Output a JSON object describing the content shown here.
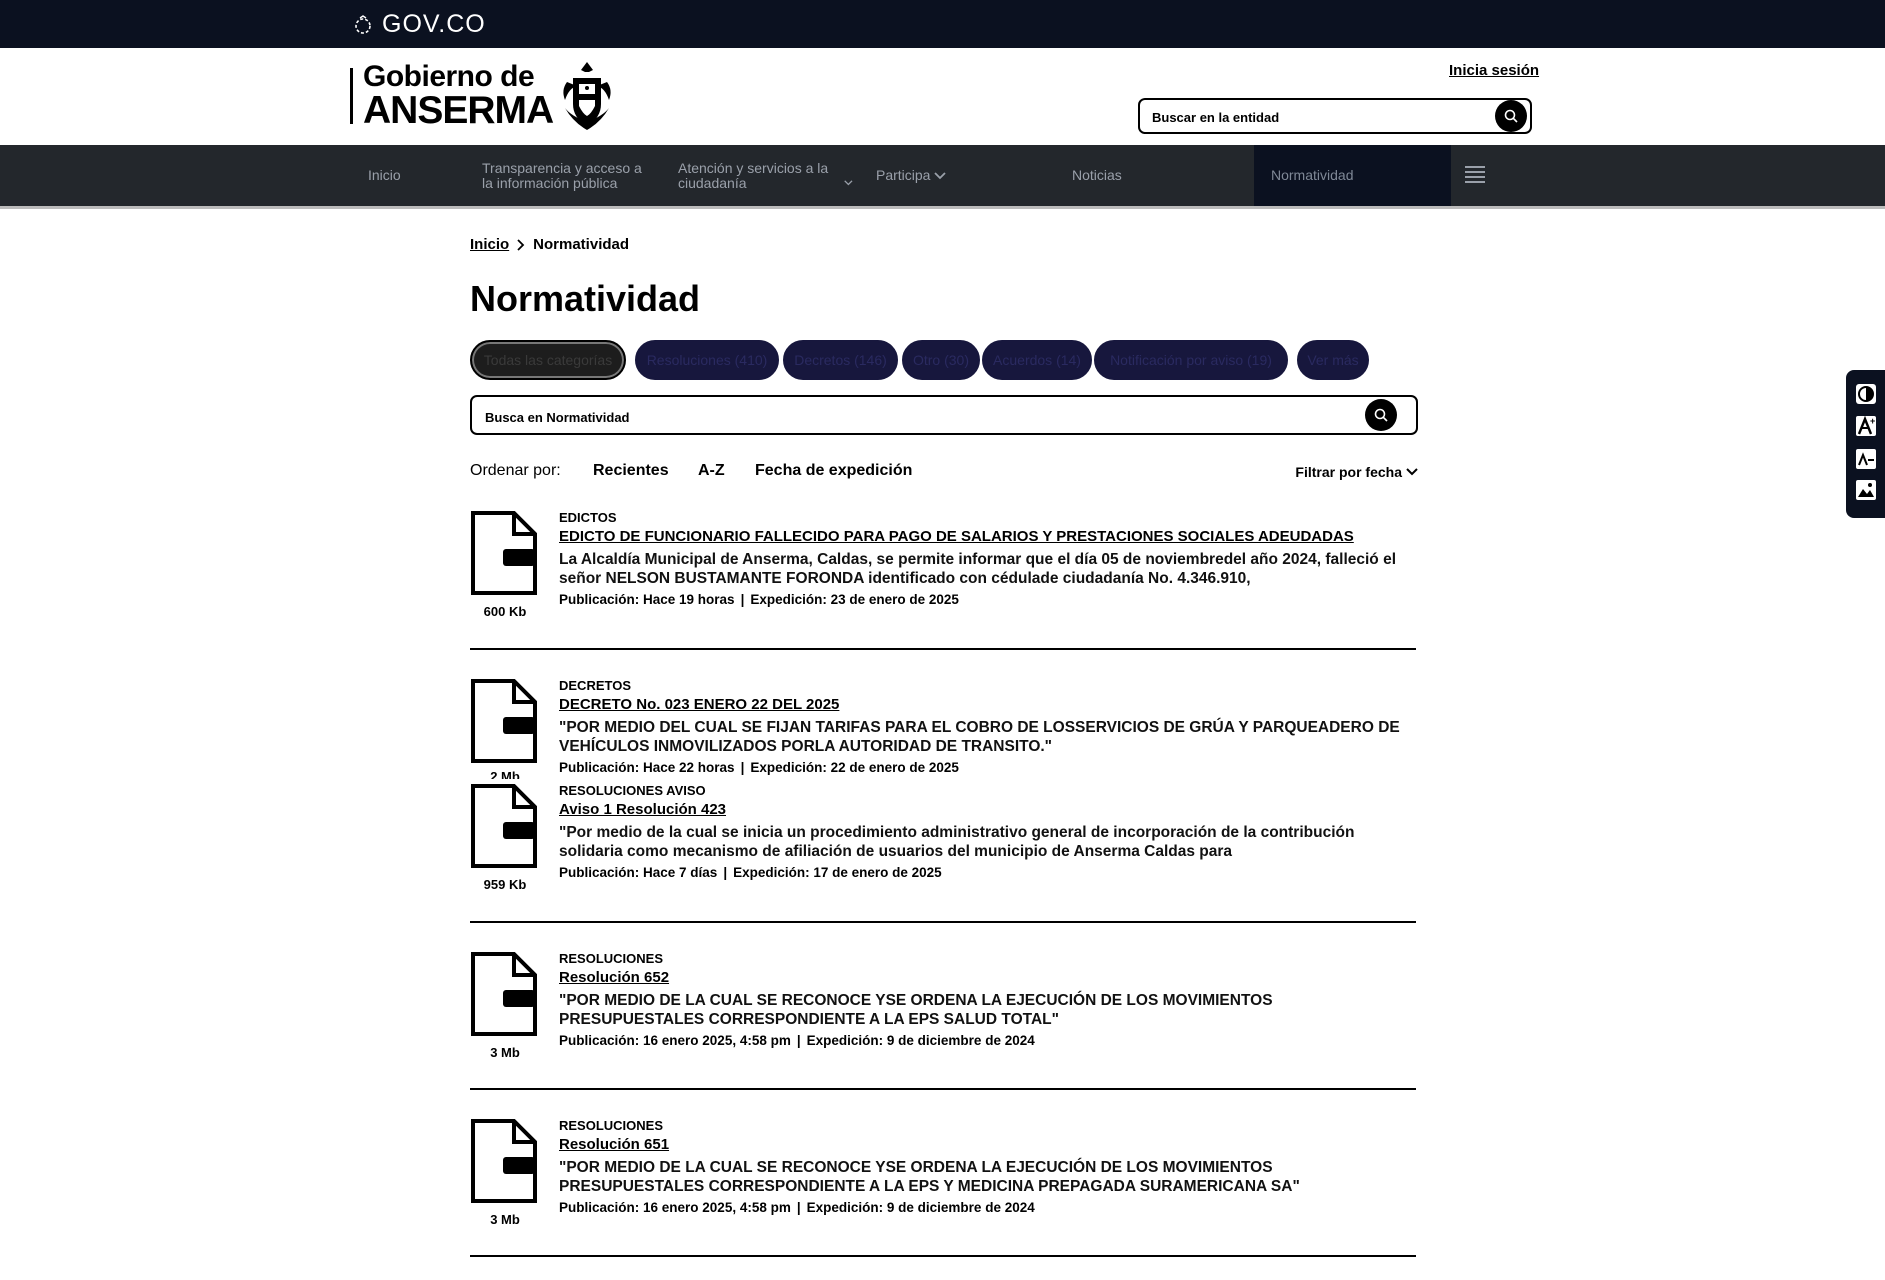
{
  "gov": {
    "label": "GOV.CO"
  },
  "brand": {
    "line1": "Gobierno de",
    "line2": "ANSERMA"
  },
  "header": {
    "login": "Inicia sesión",
    "search_placeholder": "Buscar en la entidad"
  },
  "nav": {
    "items": [
      {
        "label": "Inicio"
      },
      {
        "label": "Transparencia y acceso a la información pública"
      },
      {
        "label": "Atención y servicios a la ciudadanía"
      },
      {
        "label": "Participa"
      },
      {
        "label": "Noticias"
      },
      {
        "label": "Normatividad"
      }
    ]
  },
  "breadcrumb": {
    "home": "Inicio",
    "current": "Normatividad"
  },
  "page": {
    "title": "Normatividad"
  },
  "chips": [
    {
      "label": "Todas las categorías"
    },
    {
      "label": "Resoluciones (410)"
    },
    {
      "label": "Decretos (146)"
    },
    {
      "label": "Otro (30)"
    },
    {
      "label": "Acuerdos (14)"
    },
    {
      "label": "Notificación por aviso (19)"
    },
    {
      "label": "Ver más"
    }
  ],
  "docsearch": {
    "placeholder": "Busca en Normatividad"
  },
  "sort": {
    "label": "Ordenar por:",
    "options": [
      "Recientes",
      "A-Z",
      "Fecha de expedición"
    ],
    "filter": "Filtrar por fecha"
  },
  "documents": [
    {
      "category": "EDICTOS",
      "title": "EDICTO DE FUNCIONARIO FALLECIDO PARA PAGO DE SALARIOS Y PRESTACIONES SOCIALES ADEUDADAS",
      "description": "La Alcaldía Municipal de Anserma, Caldas, se permite informar que el día 05 de noviembredel año 2024, falleció el señor NELSON BUSTAMANTE FORONDA identificado con cédulade ciudadanía No. 4.346.910,",
      "published": "Publicación: Hace 19 horas",
      "issued": "Expedición: 23 de enero de 2025",
      "size": "600 Kb",
      "icon": "pdf-file-icon"
    },
    {
      "category": "DECRETOS",
      "title": "DECRETO No. 023 ENERO 22 DEL 2025",
      "description": "\"POR MEDIO DEL CUAL SE FIJAN TARIFAS PARA EL COBRO DE LOSSERVICIOS DE GRÚA Y PARQUEADERO DE VEHÍCULOS INMOVILIZADOS PORLA AUTORIDAD DE TRANSITO.\"",
      "published": "Publicación: Hace 22 horas",
      "issued": "Expedición: 22 de enero de 2025",
      "size": "2 Mb",
      "icon": "pdf-file-icon"
    },
    {
      "category": "RESOLUCIONES AVISO",
      "title": "Aviso 1 Resolución 423",
      "description": "\"Por medio de la cual se inicia un procedimiento administrativo general de incorporación de la contribución solidaria como mecanismo de afiliación de usuarios del municipio de Anserma Caldas para",
      "published": "Publicación: Hace 7 días",
      "issued": "Expedición: 17 de enero de 2025",
      "size": "959 Kb",
      "icon": "pdf-file-icon"
    },
    {
      "category": "RESOLUCIONES",
      "title": "Resolución 652",
      "description": "\"POR MEDIO DE LA CUAL SE RECONOCE YSE ORDENA LA EJECUCIÓN DE LOS MOVIMIENTOS PRESUPUESTALES CORRESPONDIENTE A LA EPS SALUD TOTAL\"",
      "published": "Publicación: 16 enero 2025, 4:58 pm",
      "issued": "Expedición: 9 de diciembre de 2024",
      "size": "3 Mb",
      "icon": "pdf-file-icon"
    },
    {
      "category": "RESOLUCIONES",
      "title": "Resolución 651",
      "description": "\"POR MEDIO DE LA CUAL SE RECONOCE YSE ORDENA LA EJECUCIÓN DE LOS MOVIMIENTOS PRESUPUESTALES CORRESPONDIENTE A LA EPS Y MEDICINA PREPAGADA SURAMERICANA SA\"",
      "published": "Publicación: 16 enero 2025, 4:58 pm",
      "issued": "Expedición: 9 de diciembre de 2024",
      "size": "3 Mb",
      "icon": "pdf-file-icon"
    }
  ],
  "a11y": {
    "icons": [
      "contrast-icon",
      "increase-font-icon",
      "decrease-font-icon",
      "image-icon"
    ]
  }
}
